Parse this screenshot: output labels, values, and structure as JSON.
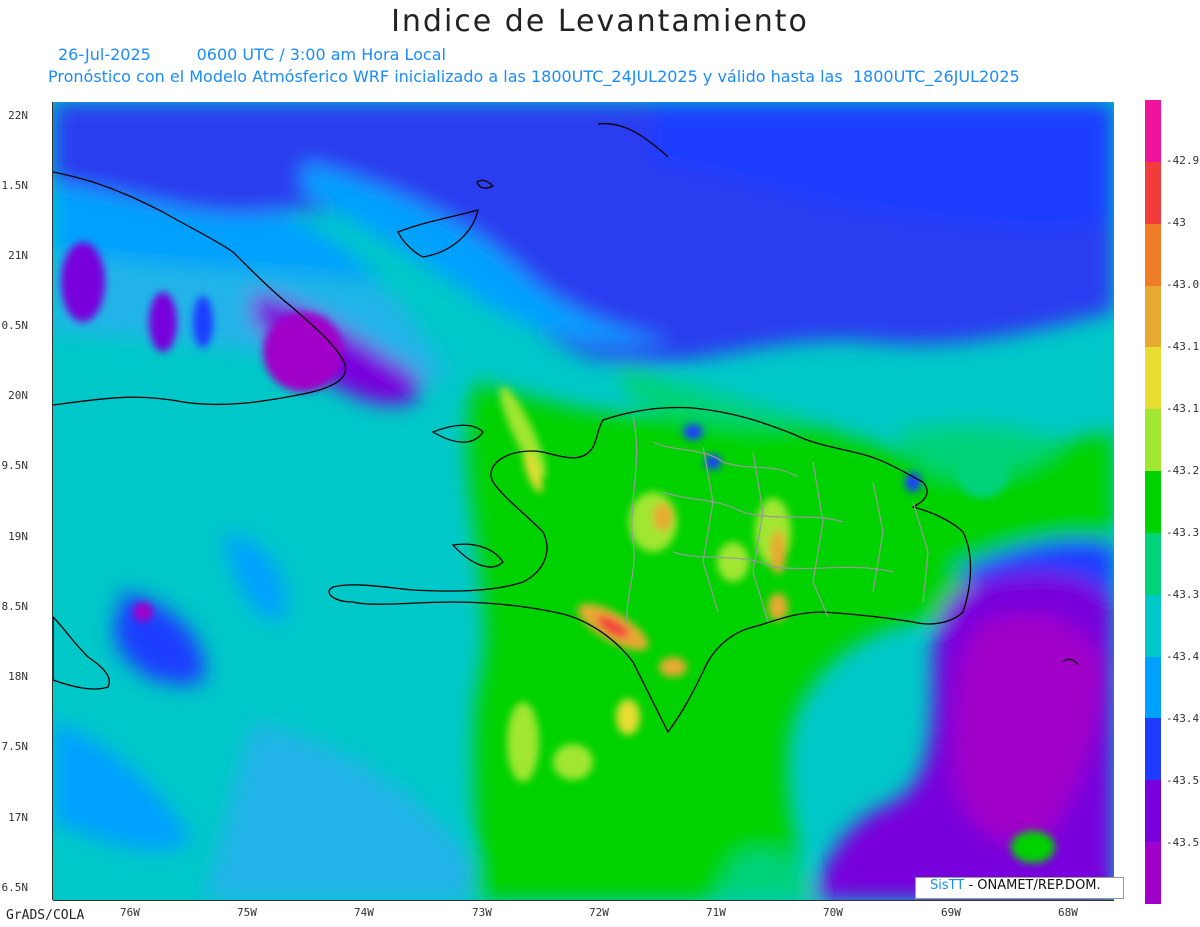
{
  "header": {
    "title": "Indice de Levantamiento",
    "date": "26-Jul-2025",
    "time": "0600 UTC / 3:00 am Hora Local",
    "forecast": "Pronóstico con el Modelo Atmósferico WRF inicializado a las 1800UTC_24JUL2025 y válido hasta las  1800UTC_26JUL2025"
  },
  "axes": {
    "lat_labels": [
      "22N",
      "1.5N",
      "21N",
      "0.5N",
      "20N",
      "9.5N",
      "19N",
      "8.5N",
      "18N",
      "7.5N",
      "17N",
      "6.5N"
    ],
    "lon_labels": [
      "76W",
      "75W",
      "74W",
      "73W",
      "72W",
      "71W",
      "70W",
      "69W",
      "68W"
    ]
  },
  "legend": {
    "labels": [
      "-42.9",
      "-43",
      "-43.0",
      "-43.1",
      "-43.1",
      "-43.2",
      "-43.3",
      "-43.3",
      "-43.4",
      "-43.4",
      "-43.5",
      "-43.5"
    ],
    "colors": [
      "#f0149b",
      "#f23c3c",
      "#f07c28",
      "#e6aa32",
      "#e6dc32",
      "#a0e632",
      "#00d200",
      "#00d27a",
      "#00c8c8",
      "#00a0ff",
      "#1e3cff",
      "#7800dc",
      "#a000c8"
    ]
  },
  "footer": {
    "software": "GrADS/COLA",
    "credit_brand": "SisTT",
    "credit_org": "- ONAMET/REP.DOM."
  }
}
